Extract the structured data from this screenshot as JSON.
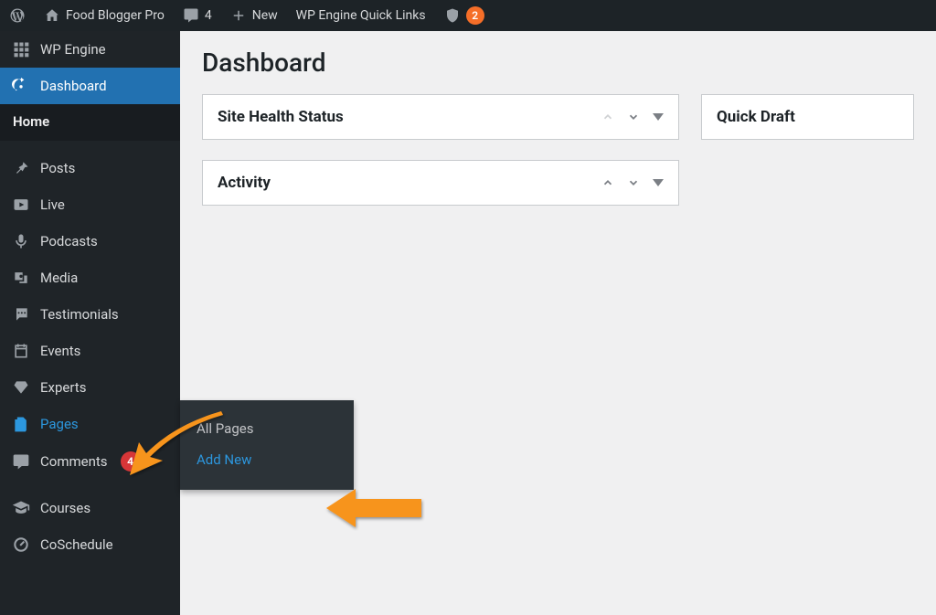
{
  "adminbar": {
    "site_name": "Food Blogger Pro",
    "comment_count": "4",
    "new_label": "New",
    "quicklinks_label": "WP Engine Quick Links",
    "notify_count": "2"
  },
  "sidebar": {
    "wp_engine": "WP Engine",
    "dashboard": "Dashboard",
    "home": "Home",
    "posts": "Posts",
    "live": "Live",
    "podcasts": "Podcasts",
    "media": "Media",
    "testimonials": "Testimonials",
    "events": "Events",
    "experts": "Experts",
    "pages": "Pages",
    "comments": "Comments",
    "comments_count": "4",
    "courses": "Courses",
    "coschedule": "CoSchedule"
  },
  "pages_flyout": {
    "all_pages": "All Pages",
    "add_new": "Add New"
  },
  "main": {
    "title": "Dashboard",
    "site_health": "Site Health Status",
    "activity": "Activity",
    "quick_draft": "Quick Draft"
  }
}
